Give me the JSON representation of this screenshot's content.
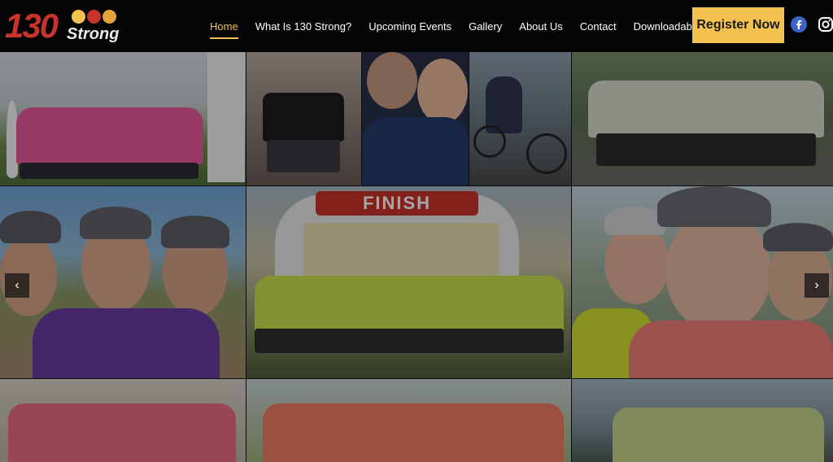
{
  "logo": {
    "number": "130",
    "word": "Strong"
  },
  "nav": {
    "items": [
      {
        "label": "Home",
        "active": true
      },
      {
        "label": "What Is 130 Strong?",
        "active": false
      },
      {
        "label": "Upcoming Events",
        "active": false
      },
      {
        "label": "Gallery",
        "active": false
      },
      {
        "label": "About Us",
        "active": false
      },
      {
        "label": "Contact",
        "active": false
      },
      {
        "label": "Downloadable Forms",
        "active": false
      }
    ],
    "register_label": "Register Now"
  },
  "social": {
    "facebook_icon": "facebook-icon",
    "instagram_icon": "instagram-icon"
  },
  "gallery": {
    "prev_icon": "chevron-left-icon",
    "next_icon": "chevron-right-icon",
    "prev_glyph": "‹",
    "next_glyph": "›",
    "finish_text": "FINISH"
  },
  "colors": {
    "accent": "#f2c14e",
    "brand_red": "#c8332b",
    "header_bg": "#050507"
  }
}
